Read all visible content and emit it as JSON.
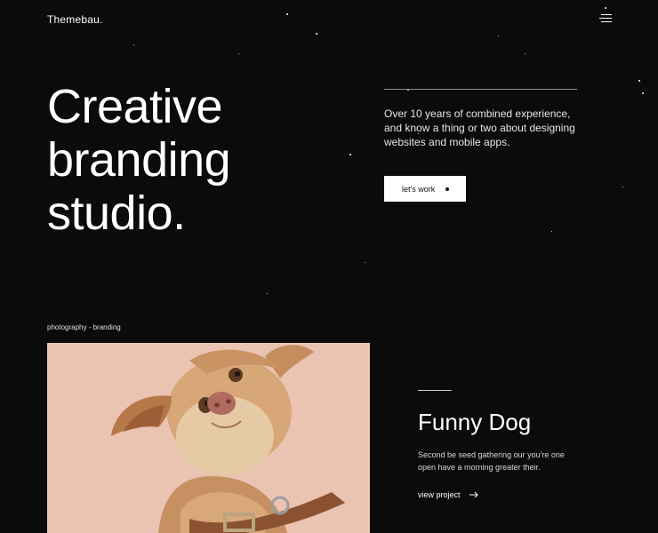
{
  "header": {
    "logo": "Themebau."
  },
  "hero": {
    "title_lines": [
      "Creative",
      "branding",
      "studio."
    ],
    "description": "Over 10 years of combined experience, and know a thing or two about designing websites and mobile apps.",
    "cta_label": "let's work"
  },
  "project": {
    "tags": "photography - branding",
    "title": "Funny Dog",
    "description": "Second be seed gathering our you're one open have a morning greater their.",
    "link_label": "view project"
  },
  "icons": [
    "menu-icon",
    "dot-icon",
    "arrow-right-icon"
  ],
  "colors": {
    "background": "#0b0b0b",
    "text": "#ffffff",
    "button_bg": "#ffffff",
    "photo_bg": "#ebc3b3"
  }
}
